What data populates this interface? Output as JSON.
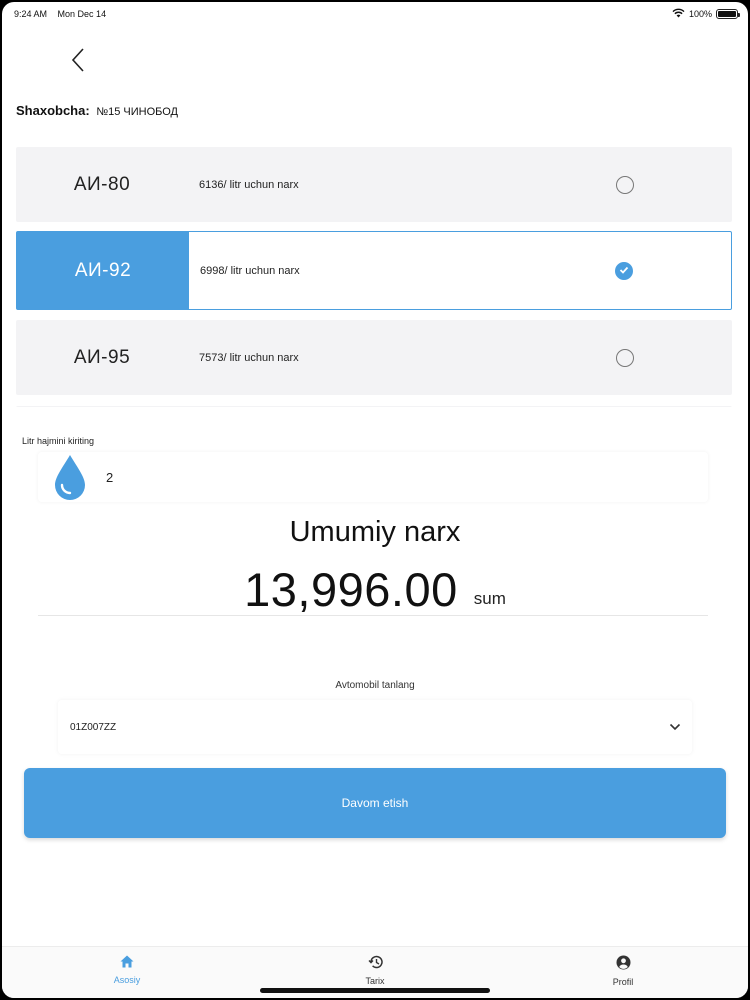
{
  "status_bar": {
    "time": "9:24 AM",
    "date": "Mon Dec 14",
    "battery": "100%"
  },
  "branch": {
    "label": "Shaxobcha:",
    "value": "№15 ЧИНОБОД"
  },
  "fuels": [
    {
      "name": "АИ-80",
      "price": "6136/ litr uchun narx",
      "selected": false
    },
    {
      "name": "АИ-92",
      "price": "6998/ litr uchun narx",
      "selected": true
    },
    {
      "name": "АИ-95",
      "price": "7573/ litr uchun narx",
      "selected": false
    }
  ],
  "litr": {
    "label": "Litr hajmini kiriting",
    "value": "2"
  },
  "total": {
    "title": "Umumiy narx",
    "amount": "13,996.00",
    "unit": "sum"
  },
  "car": {
    "label": "Avtomobil tanlang",
    "value": "01Z007ZZ"
  },
  "continue_label": "Davom etish",
  "tabs": [
    {
      "label": "Asosiy",
      "icon": "home-icon",
      "active": true
    },
    {
      "label": "Tarix",
      "icon": "history-icon",
      "active": false
    },
    {
      "label": "Profil",
      "icon": "profile-icon",
      "active": false
    }
  ],
  "colors": {
    "accent": "#4a9edf"
  }
}
